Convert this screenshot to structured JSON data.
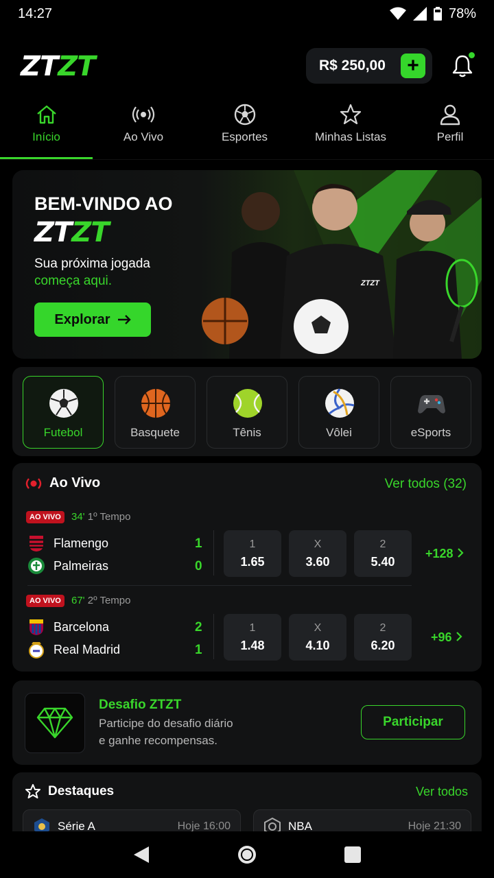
{
  "status_bar": {
    "time": "14:27",
    "battery": "78%"
  },
  "header": {
    "logo_white": "ZT",
    "logo_green": "ZT",
    "balance": "R$ 250,00",
    "add_symbol": "+"
  },
  "nav": {
    "tabs": [
      {
        "label": "Início",
        "icon": "home-icon",
        "active": true
      },
      {
        "label": "Ao Vivo",
        "icon": "broadcast-icon"
      },
      {
        "label": "Esportes",
        "icon": "soccer-ball-icon"
      },
      {
        "label": "Minhas Listas",
        "icon": "star-icon"
      },
      {
        "label": "Perfil",
        "icon": "user-icon"
      }
    ]
  },
  "banner": {
    "title": "BEM-VINDO AO",
    "logo_white": "ZT",
    "logo_green": "ZT",
    "subtitle_line1": "Sua próxima jogada",
    "subtitle_line2": "começa aqui.",
    "cta": "Explorar",
    "jersey_text": "ZTZT"
  },
  "sports": [
    {
      "label": "Futebol",
      "icon": "soccer-icon",
      "active": true
    },
    {
      "label": "Basquete",
      "icon": "basketball-icon"
    },
    {
      "label": "Tênis",
      "icon": "tennis-icon"
    },
    {
      "label": "Vôlei",
      "icon": "volleyball-icon"
    },
    {
      "label": "eSports",
      "icon": "gamepad-icon"
    }
  ],
  "live": {
    "title": "Ao Vivo",
    "see_all": "Ver todos (32)",
    "matches": [
      {
        "badge": "AO VIVO",
        "minute": "34'",
        "period": "1º Tempo",
        "home": "Flamengo",
        "away": "Palmeiras",
        "home_score": "1",
        "away_score": "0",
        "odds": [
          {
            "label": "1",
            "value": "1.65"
          },
          {
            "label": "X",
            "value": "3.60"
          },
          {
            "label": "2",
            "value": "5.40"
          }
        ],
        "more": "+128"
      },
      {
        "badge": "AO VIVO",
        "minute": "67'",
        "period": "2º Tempo",
        "home": "Barcelona",
        "away": "Real Madrid",
        "home_score": "2",
        "away_score": "1",
        "odds": [
          {
            "label": "1",
            "value": "1.48"
          },
          {
            "label": "X",
            "value": "4.10"
          },
          {
            "label": "2",
            "value": "6.20"
          }
        ],
        "more": "+96"
      }
    ]
  },
  "challenge": {
    "title": "Desafio ZTZT",
    "desc_line1": "Participe do desafio diário",
    "desc_line2": "e ganhe recompensas.",
    "button": "Participar"
  },
  "highlights": {
    "title": "Destaques",
    "see_all": "Ver todos",
    "items": [
      {
        "name": "Série A",
        "time": "Hoje 16:00"
      },
      {
        "name": "NBA",
        "time": "Hoje 21:30"
      }
    ]
  },
  "colors": {
    "accent": "#39d62b",
    "live_red": "#c0121e",
    "background": "#000000",
    "card": "#121314"
  }
}
